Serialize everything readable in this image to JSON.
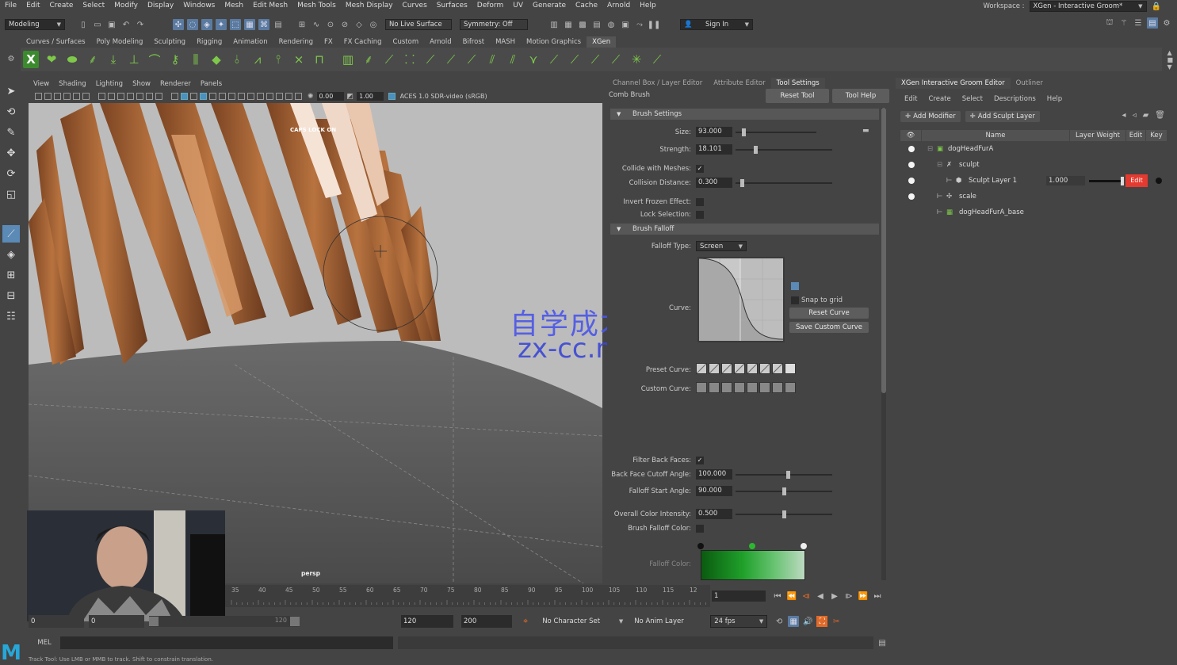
{
  "menubar": {
    "items": [
      "File",
      "Edit",
      "Create",
      "Select",
      "Modify",
      "Display",
      "Windows",
      "Mesh",
      "Edit Mesh",
      "Mesh Tools",
      "Mesh Display",
      "Curves",
      "Surfaces",
      "Deform",
      "UV",
      "Generate",
      "Cache",
      "Arnold",
      "Help"
    ],
    "workspace_label": "Workspace :",
    "workspace_value": "XGen - Interactive Groom*"
  },
  "statusline": {
    "mode": "Modeling",
    "live_surface": "No Live Surface",
    "symmetry": "Symmetry: Off",
    "sign_in": "Sign In"
  },
  "shelf": {
    "tabs": [
      "Curves / Surfaces",
      "Poly Modeling",
      "Sculpting",
      "Rigging",
      "Animation",
      "Rendering",
      "FX",
      "FX Caching",
      "Custom",
      "Arnold",
      "Bifrost",
      "MASH",
      "Motion Graphics",
      "XGen"
    ],
    "active_tab": "XGen"
  },
  "viewport": {
    "menu": [
      "View",
      "Shading",
      "Lighting",
      "Show",
      "Renderer",
      "Panels"
    ],
    "field_a": "0.00",
    "field_b": "1.00",
    "color_space": "ACES 1.0 SDR-video (sRGB)",
    "caps_warning": "CAPS LOCK ON",
    "camera": "persp"
  },
  "mid_panel": {
    "tabs": [
      "Channel Box / Layer Editor",
      "Attribute Editor",
      "Tool Settings"
    ],
    "active_tab": "Tool Settings",
    "tool_name": "Comb Brush",
    "reset_tool": "Reset Tool",
    "tool_help": "Tool Help",
    "brush_settings": {
      "title": "Brush Settings",
      "size_label": "Size:",
      "size": "93.000",
      "size_level": 0.08,
      "strength_label": "Strength:",
      "strength": "18.101",
      "strength_level": 0.2,
      "collide_label": "Collide with Meshes:",
      "collide": "✓",
      "collision_label": "Collision Distance:",
      "collision": "0.300",
      "collision_level": 0.05,
      "invert_label": "Invert Frozen Effect:",
      "lock_label": "Lock Selection:"
    },
    "brush_falloff": {
      "title": "Brush Falloff",
      "falloff_type_label": "Falloff Type:",
      "falloff_type": "Screen",
      "curve_label": "Curve:",
      "snap_label": "Snap to grid",
      "reset_curve": "Reset Curve",
      "save_curve": "Save Custom Curve",
      "preset_label": "Preset Curve:",
      "custom_label": "Custom Curve:",
      "filter_label": "Filter Back Faces:",
      "filter": "✓",
      "cutoff_label": "Back Face Cutoff Angle:",
      "cutoff": "100.000",
      "cutoff_level": 0.55,
      "start_label": "Falloff Start Angle:",
      "start": "90.000",
      "start_level": 0.5,
      "intensity_label": "Overall Color Intensity:",
      "intensity": "0.500",
      "intensity_level": 0.5,
      "color_label": "Brush Falloff Color:",
      "falloff_color_label": "Falloff Color:"
    }
  },
  "right_panel": {
    "tabs": [
      "XGen Interactive Groom Editor",
      "Outliner"
    ],
    "active_tab": "XGen Interactive Groom Editor",
    "menu": [
      "Edit",
      "Create",
      "Select",
      "Descriptions",
      "Help"
    ],
    "add_modifier": "Add Modifier",
    "add_sculpt_layer": "Add Sculpt Layer",
    "columns": [
      "Name",
      "Layer Weight",
      "Edit",
      "Key"
    ],
    "rows": [
      {
        "name": "dogHeadFurA"
      },
      {
        "name": "sculpt"
      },
      {
        "name": "Sculpt Layer 1",
        "weight": "1.000",
        "edit": "Edit"
      },
      {
        "name": "scale"
      },
      {
        "name": "dogHeadFurA_base"
      }
    ]
  },
  "timeline": {
    "ticks": [
      "35",
      "40",
      "45",
      "50",
      "55",
      "60",
      "65",
      "70",
      "75",
      "80",
      "85",
      "90",
      "95",
      "100",
      "105",
      "110",
      "115",
      "12"
    ],
    "current_frame": "1"
  },
  "range": {
    "start": "0",
    "range_start": "0",
    "range_end": "120",
    "end": "120",
    "total_end": "200",
    "character_set": "No Character Set",
    "anim_layer": "No Anim Layer",
    "fps": "24 fps"
  },
  "cmdline": {
    "lang": "MEL",
    "help": "Track Tool: Use LMB or MMB to track. Shift to constrain translation."
  },
  "watermark": {
    "line1": "自学成才网",
    "line2": "zx-cc.net"
  },
  "colors": {
    "accent_blue": "#5a8ab5",
    "edit_red": "#e53a2f",
    "xgen_green": "#7ec84a"
  }
}
